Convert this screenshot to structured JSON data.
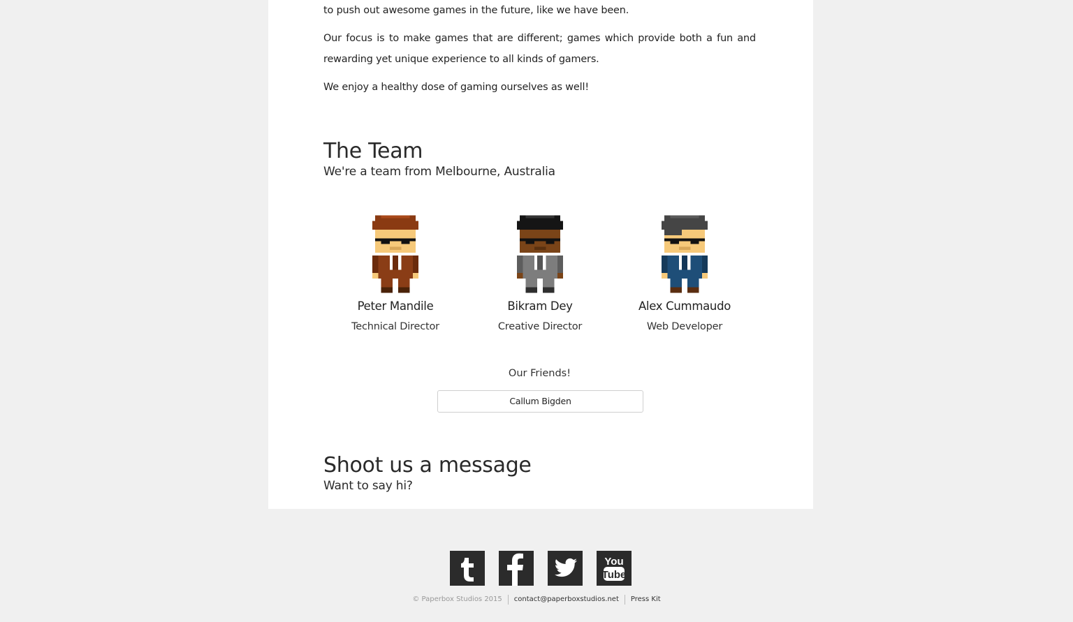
{
  "about": {
    "para1_tail": "to push out awesome games in the future, like we have been.",
    "para2": "Our focus is to make games that are different; games which provide both a fun and rewarding yet unique experience to all kinds of gamers.",
    "para3": "We enjoy a healthy dose of gaming ourselves as well!"
  },
  "team": {
    "title": "The Team",
    "subtitle": "We're a team from Melbourne, Australia",
    "members": [
      {
        "name": "Peter Mandile",
        "role": "Technical Director",
        "avatar": "pixel-avatar-brown-hair-brown-suit"
      },
      {
        "name": "Bikram Dey",
        "role": "Creative Director",
        "avatar": "pixel-avatar-black-hair-grey-suit"
      },
      {
        "name": "Alex Cummaudo",
        "role": "Web Developer",
        "avatar": "pixel-avatar-grey-hair-blue-suit"
      }
    ],
    "friends_label": "Our Friends!",
    "friends": [
      "Callum Bigden"
    ]
  },
  "contact": {
    "title": "Shoot us a message",
    "subtitle": "Want to say hi?"
  },
  "social": [
    {
      "name": "tumblr-icon",
      "glyph": "t"
    },
    {
      "name": "facebook-icon",
      "glyph": "f"
    },
    {
      "name": "twitter-icon",
      "glyph": "bird"
    },
    {
      "name": "youtube-icon",
      "glyph": "You Tube"
    }
  ],
  "footer": {
    "copyright": "© Paperbox Studios 2015",
    "email": "contact@paperboxstudios.net",
    "press_kit": "Press Kit"
  },
  "colors": {
    "background": "#f0f0f0",
    "content_bg": "#ffffff",
    "social_tile": "#2b2b2b"
  }
}
